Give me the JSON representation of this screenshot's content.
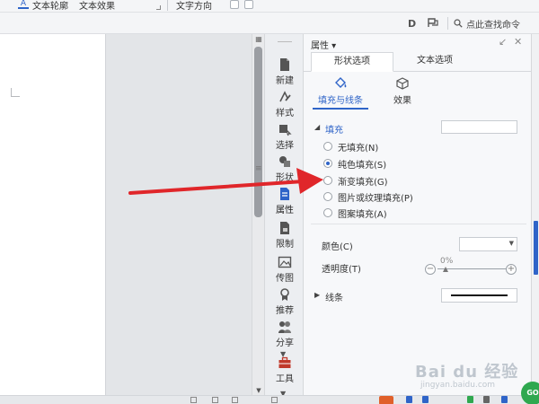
{
  "ribbon": {
    "text_outline_label": "文本轮廓",
    "text_effects_label": "文本效果",
    "text_direction_label": "文字方向"
  },
  "toolbar": {
    "icon_d": "D",
    "search_label": "点此查找命令"
  },
  "rail": {
    "items": [
      {
        "label": "新建",
        "icon": "new-doc-icon"
      },
      {
        "label": "样式",
        "icon": "style-icon"
      },
      {
        "label": "选择",
        "icon": "select-icon"
      },
      {
        "label": "形状",
        "icon": "shape-icon"
      },
      {
        "label": "属性",
        "icon": "property-icon"
      },
      {
        "label": "限制",
        "icon": "restrict-icon"
      },
      {
        "label": "传图",
        "icon": "upload-image-icon"
      },
      {
        "label": "推荐",
        "icon": "recommend-icon"
      },
      {
        "label": "分享",
        "icon": "share-icon"
      },
      {
        "label": "工具",
        "icon": "toolbox-icon"
      }
    ],
    "active_index": 4
  },
  "panel": {
    "title": "属性",
    "tabs": [
      {
        "label": "形状选项",
        "active": true
      },
      {
        "label": "文本选项",
        "active": false
      }
    ],
    "subtabs": [
      {
        "label": "填充与线条",
        "active": true
      },
      {
        "label": "效果",
        "active": false
      }
    ],
    "fill": {
      "title": "填充",
      "options": [
        {
          "label": "无填充(N)",
          "checked": false
        },
        {
          "label": "纯色填充(S)",
          "checked": true
        },
        {
          "label": "渐变填充(G)",
          "checked": false
        },
        {
          "label": "图片或纹理填充(P)",
          "checked": false
        },
        {
          "label": "图案填充(A)",
          "checked": false
        }
      ],
      "color_label": "颜色(C)",
      "transparency_label": "透明度(T)",
      "transparency_value": "0%"
    },
    "line": {
      "title": "线条"
    }
  },
  "watermark": {
    "main": "Bai du 经验",
    "sub": "jingyan.baidu.com"
  },
  "badge": "GO",
  "colors": {
    "accent": "#2f64c8",
    "arrow": "#e0262a",
    "panel_bg": "#f7f8fa"
  }
}
